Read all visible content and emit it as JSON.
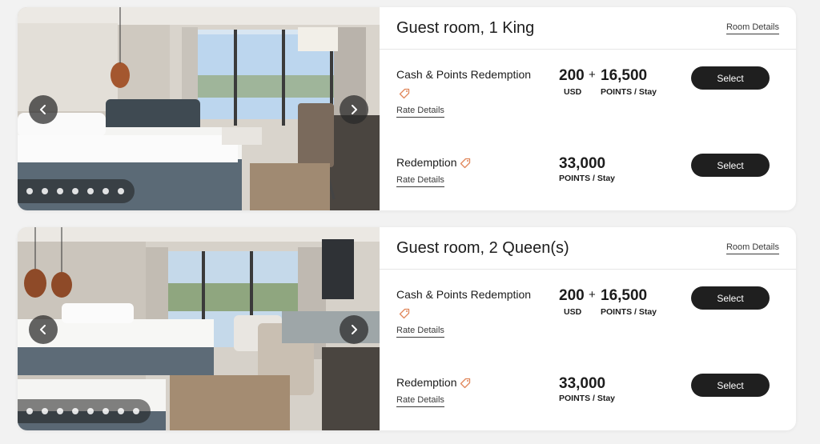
{
  "colors": {
    "background": "#f2f2f2",
    "card": "#ffffff",
    "button": "#1f1f1f",
    "tag_accent": "#e0865a"
  },
  "rooms": [
    {
      "title": "Guest room, 1 King",
      "room_details_label": "Room Details",
      "carousel": {
        "prev_icon": "chevron-left-icon",
        "next_icon": "chevron-right-icon",
        "dot_count": 7
      },
      "rates": [
        {
          "name": "Cash & Points Redemption",
          "tag_icon": "tag-icon",
          "rate_details_label": "Rate Details",
          "cash_amount": "200",
          "cash_unit": "USD",
          "plus": "+",
          "points_amount": "16,500",
          "points_unit": "POINTS / Stay",
          "select_label": "Select"
        },
        {
          "name": "Redemption",
          "tag_icon": "tag-icon",
          "rate_details_label": "Rate Details",
          "points_amount": "33,000",
          "points_unit": "POINTS / Stay",
          "select_label": "Select"
        }
      ]
    },
    {
      "title": "Guest room, 2 Queen(s)",
      "room_details_label": "Room Details",
      "carousel": {
        "prev_icon": "chevron-left-icon",
        "next_icon": "chevron-right-icon",
        "dot_count": 8
      },
      "rates": [
        {
          "name": "Cash & Points Redemption",
          "tag_icon": "tag-icon",
          "rate_details_label": "Rate Details",
          "cash_amount": "200",
          "cash_unit": "USD",
          "plus": "+",
          "points_amount": "16,500",
          "points_unit": "POINTS / Stay",
          "select_label": "Select"
        },
        {
          "name": "Redemption",
          "tag_icon": "tag-icon",
          "rate_details_label": "Rate Details",
          "points_amount": "33,000",
          "points_unit": "POINTS / Stay",
          "select_label": "Select"
        }
      ]
    }
  ]
}
